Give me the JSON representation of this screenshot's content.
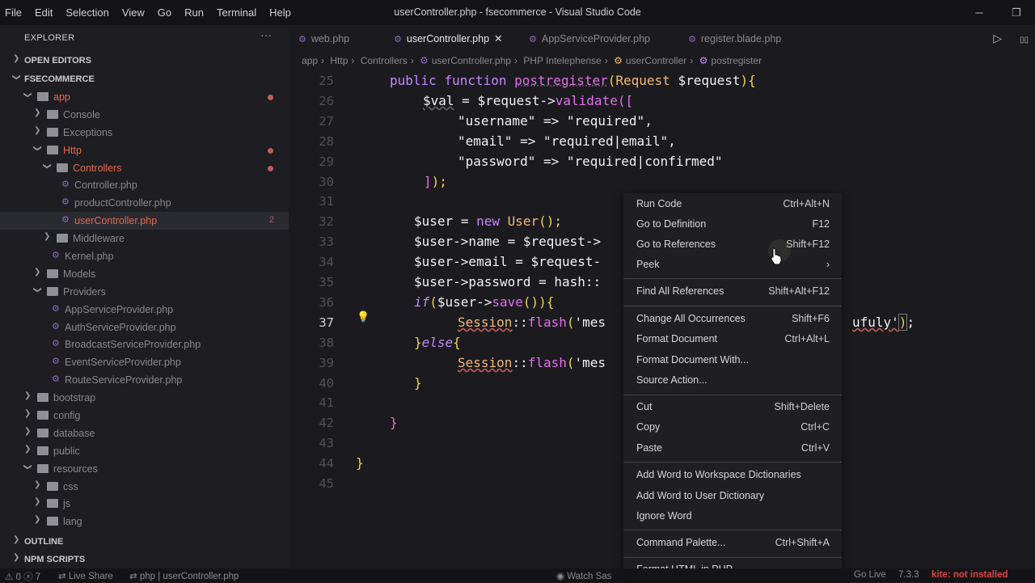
{
  "menu": [
    "File",
    "Edit",
    "Selection",
    "View",
    "Go",
    "Run",
    "Terminal",
    "Help"
  ],
  "window_title": "userController.php - fsecommerce - Visual Studio Code",
  "window_buttons": {
    "minimize": "─",
    "restore": "❐"
  },
  "sidebar": {
    "header": "EXPLORER",
    "dots": "···",
    "open_editors": "OPEN EDITORS",
    "project": "FSECOMMERCE",
    "tree": [
      {
        "label": "app",
        "type": "folder",
        "open": true,
        "depth": 1,
        "color": "#e46b4f",
        "dot": true
      },
      {
        "label": "Console",
        "type": "folder",
        "open": false,
        "depth": 2,
        "color": "#8a8a8a"
      },
      {
        "label": "Exceptions",
        "type": "folder",
        "open": false,
        "depth": 2,
        "color": "#8a8a8a"
      },
      {
        "label": "Http",
        "type": "folder",
        "open": true,
        "depth": 2,
        "color": "#e46b4f",
        "dot": true
      },
      {
        "label": "Controllers",
        "type": "folder",
        "open": true,
        "depth": 3,
        "color": "#e46b4f",
        "dot": true
      },
      {
        "label": "Controller.php",
        "type": "php",
        "depth": 4,
        "color": "#8a8a8a"
      },
      {
        "label": "productController.php",
        "type": "php",
        "depth": 4,
        "color": "#8a8a8a"
      },
      {
        "label": "userController.php",
        "type": "php",
        "depth": 4,
        "color": "#e46b4f",
        "badge": "2",
        "selected": true
      },
      {
        "label": "Middleware",
        "type": "folder",
        "open": false,
        "depth": 3,
        "color": "#8a8a8a"
      },
      {
        "label": "Kernel.php",
        "type": "php",
        "depth": 3,
        "color": "#8a8a8a"
      },
      {
        "label": "Models",
        "type": "folder",
        "open": false,
        "depth": 2,
        "color": "#8a8a8a"
      },
      {
        "label": "Providers",
        "type": "folder",
        "open": true,
        "depth": 2,
        "color": "#8a8a8a"
      },
      {
        "label": "AppServiceProvider.php",
        "type": "php",
        "depth": 3,
        "color": "#8a8a8a"
      },
      {
        "label": "AuthServiceProvider.php",
        "type": "php",
        "depth": 3,
        "color": "#8a8a8a"
      },
      {
        "label": "BroadcastServiceProvider.php",
        "type": "php",
        "depth": 3,
        "color": "#8a8a8a"
      },
      {
        "label": "EventServiceProvider.php",
        "type": "php",
        "depth": 3,
        "color": "#8a8a8a"
      },
      {
        "label": "RouteServiceProvider.php",
        "type": "php",
        "depth": 3,
        "color": "#8a8a8a"
      },
      {
        "label": "bootstrap",
        "type": "folder",
        "open": false,
        "depth": 1,
        "color": "#8a8a8a"
      },
      {
        "label": "config",
        "type": "folder",
        "open": false,
        "depth": 1,
        "color": "#8a8a8a"
      },
      {
        "label": "database",
        "type": "folder",
        "open": false,
        "depth": 1,
        "color": "#8a8a8a"
      },
      {
        "label": "public",
        "type": "folder",
        "open": false,
        "depth": 1,
        "color": "#8a8a8a"
      },
      {
        "label": "resources",
        "type": "folder",
        "open": true,
        "depth": 1,
        "color": "#8a8a8a"
      },
      {
        "label": "css",
        "type": "folder",
        "open": false,
        "depth": 2,
        "color": "#8a8a8a"
      },
      {
        "label": "js",
        "type": "folder",
        "open": false,
        "depth": 2,
        "color": "#8a8a8a"
      },
      {
        "label": "lang",
        "type": "folder",
        "open": false,
        "depth": 2,
        "color": "#8a8a8a"
      }
    ],
    "outline": "OUTLINE",
    "npm": "NPM SCRIPTS"
  },
  "tabs": [
    {
      "label": "web.php",
      "active": false
    },
    {
      "label": "userController.php",
      "active": true,
      "close": "✕"
    },
    {
      "label": "AppServiceProvider.php",
      "active": false
    },
    {
      "label": "register.blade.php",
      "active": false
    }
  ],
  "tab_icons": {
    "run": "▷",
    "split": "▯▯"
  },
  "breadcrumb": [
    "app",
    "Http",
    "Controllers",
    "userController.php",
    "PHP Intelephense",
    "userController",
    "postregister"
  ],
  "editor": {
    "lines": [
      25,
      26,
      27,
      28,
      29,
      30,
      31,
      32,
      33,
      34,
      35,
      36,
      37,
      38,
      39,
      40,
      41,
      42,
      43,
      44,
      45
    ],
    "current_line": 37
  },
  "code": {
    "l25": [
      "public",
      "function",
      "postregister",
      "(",
      "Request",
      "$request",
      "){"
    ],
    "l26": [
      "$val",
      "= ",
      "$request",
      "->",
      "validate",
      "(["
    ],
    "l27": [
      "\"username\" => \"required\","
    ],
    "l28": [
      "\"email\" => \"required|email\","
    ],
    "l29": [
      "\"password\" => \"required|confirmed\""
    ],
    "l30": [
      "]",
      "); "
    ],
    "l32": [
      "$user",
      "= ",
      "new ",
      "User",
      "();"
    ],
    "l33": [
      "$user->name = $request->"
    ],
    "l34": [
      "$user->email = $request-"
    ],
    "l35": [
      "$user->password = hash::"
    ],
    "l36": [
      "if",
      "(",
      "$user->",
      "save",
      "()){"
    ],
    "l37": [
      "Session",
      "::",
      "flash",
      "(",
      "'mes"
    ],
    "l37b": [
      "ufuly'",
      ")",
      ";"
    ],
    "l38": [
      "}",
      "else",
      "{"
    ],
    "l39": [
      "Session",
      "::",
      "flash",
      "(",
      "'mes"
    ],
    "l40": [
      "}"
    ],
    "l42": [
      "}"
    ],
    "l44": [
      "}"
    ]
  },
  "context_menu": [
    {
      "label": "Run Code",
      "key": "Ctrl+Alt+N"
    },
    {
      "label": "Go to Definition",
      "key": "F12"
    },
    {
      "label": "Go to References",
      "key": "Shift+F12"
    },
    {
      "label": "Peek",
      "key": "›"
    },
    {
      "label": "Find All References",
      "key": "Shift+Alt+F12"
    },
    {
      "label": "Change All Occurrences",
      "key": "Shift+F6"
    },
    {
      "label": "Format Document",
      "key": "Ctrl+Alt+L"
    },
    {
      "label": "Format Document With...",
      "key": ""
    },
    {
      "label": "Source Action...",
      "key": ""
    },
    {
      "label": "Cut",
      "key": "Shift+Delete"
    },
    {
      "label": "Copy",
      "key": "Ctrl+C"
    },
    {
      "label": "Paste",
      "key": "Ctrl+V"
    },
    {
      "label": "Add Word to Workspace Dictionaries",
      "key": ""
    },
    {
      "label": "Add Word to User Dictionary",
      "key": ""
    },
    {
      "label": "Ignore Word",
      "key": ""
    },
    {
      "label": "Command Palette...",
      "key": "Ctrl+Shift+A"
    },
    {
      "label": "Format HTML in PHP",
      "key": ""
    }
  ],
  "status": {
    "problems": "⚠ 0 ⓧ 7",
    "live_share": "Live Share",
    "php": "php | userController.php",
    "watch": "Watch Sas",
    "golive": "Go Live",
    "version": "7.3.3",
    "kite": "kite: not installed"
  }
}
